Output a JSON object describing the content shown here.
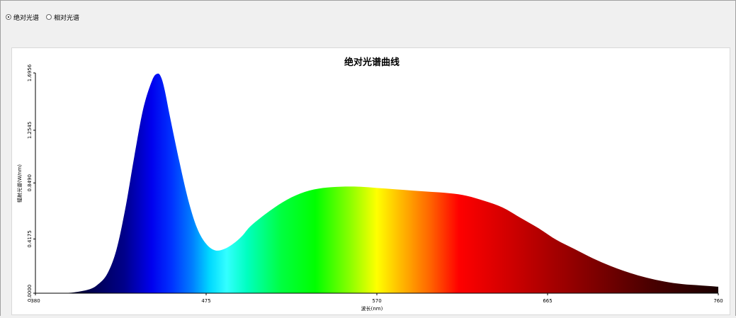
{
  "radio_options": [
    {
      "label": "绝对光谱",
      "checked": true
    },
    {
      "label": "相对光谱",
      "checked": false
    }
  ],
  "chart_data": {
    "type": "area",
    "title": "绝对光谱曲线",
    "xlabel": "波长(nm)",
    "ylabel": "辐射光谱(W/nm)",
    "xlim": [
      380,
      760
    ],
    "ylim": [
      0,
      1.6956
    ],
    "x_ticks": [
      "380",
      "475",
      "570",
      "665",
      "760"
    ],
    "y_ticks": [
      "0.0000",
      "0.4175",
      "0.8490",
      "1.2545",
      "1.6956"
    ],
    "grid": false,
    "fill": "wavelength-colored spectrum",
    "x": [
      380,
      390,
      400,
      410,
      415,
      420,
      425,
      430,
      435,
      440,
      445,
      448,
      450,
      452,
      455,
      460,
      465,
      470,
      475,
      480,
      485,
      490,
      495,
      500,
      510,
      520,
      530,
      540,
      550,
      560,
      570,
      580,
      590,
      600,
      610,
      620,
      630,
      640,
      650,
      660,
      670,
      680,
      690,
      700,
      710,
      720,
      730,
      740,
      750,
      760
    ],
    "y": [
      0,
      0,
      0.004,
      0.03,
      0.07,
      0.15,
      0.33,
      0.65,
      1.05,
      1.42,
      1.64,
      1.69,
      1.66,
      1.56,
      1.35,
      1.02,
      0.72,
      0.5,
      0.38,
      0.33,
      0.34,
      0.38,
      0.44,
      0.52,
      0.63,
      0.72,
      0.78,
      0.81,
      0.82,
      0.82,
      0.81,
      0.8,
      0.79,
      0.78,
      0.77,
      0.75,
      0.71,
      0.66,
      0.58,
      0.5,
      0.41,
      0.34,
      0.27,
      0.21,
      0.16,
      0.12,
      0.09,
      0.07,
      0.06,
      0.05
    ]
  }
}
